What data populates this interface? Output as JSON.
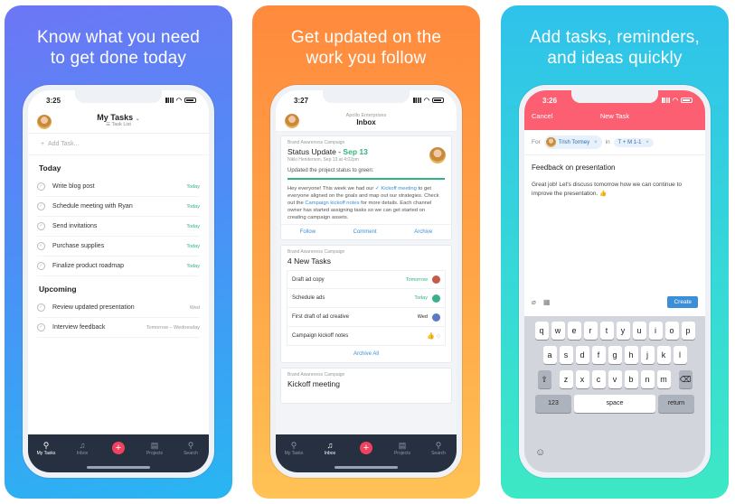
{
  "cards": [
    {
      "caption": [
        "Know what you need",
        "to get done today"
      ]
    },
    {
      "caption": [
        "Get updated on the",
        "work you follow"
      ]
    },
    {
      "caption": [
        "Add tasks, reminders,",
        "and ideas quickly"
      ]
    }
  ],
  "phone1": {
    "time": "3:25",
    "title": "My Tasks",
    "subtitle": "Task List",
    "add_task": "Add Task...",
    "today_label": "Today",
    "today_tasks": [
      {
        "label": "Write blog post",
        "due": "Today"
      },
      {
        "label": "Schedule meeting with Ryan",
        "due": "Today"
      },
      {
        "label": "Send invitations",
        "due": "Today"
      },
      {
        "label": "Purchase supplies",
        "due": "Today"
      },
      {
        "label": "Finalize product roadmap",
        "due": "Today"
      }
    ],
    "upcoming_label": "Upcoming",
    "upcoming_tasks": [
      {
        "label": "Review updated presentation",
        "due": "Wed"
      },
      {
        "label": "Interview feedback",
        "due": "Tomorrow – Wednesday"
      }
    ],
    "tabs": [
      "My Tasks",
      "Inbox",
      "",
      "Projects",
      "Search"
    ]
  },
  "phone2": {
    "time": "3:27",
    "workspace": "Apollo Enterprises",
    "title": "Inbox",
    "card1": {
      "project": "Brand Awareness Campaign",
      "title_prefix": "Status Update - ",
      "title_date": "Sep 13",
      "byline": "Nikki Henderson, Sep 13 at 4:02pm",
      "status_msg": "Updated the project status to green:",
      "body_1": "Hey everyone! This week we had our ",
      "body_link1": "✓ Kickoff meeting",
      "body_2": " to get everyone aligned on the goals and map out our strategies. Check out the ",
      "body_link2": "Campaign kickoff notes",
      "body_3": " for more details. Each channel owner has started assigning tasks so we can get started on creating campaign assets.",
      "actions": [
        "Follow",
        "Comment",
        "Archive"
      ]
    },
    "card2": {
      "project": "Brand Awareness Campaign",
      "title": "4 New Tasks",
      "tasks": [
        {
          "label": "Draft ad copy",
          "due": "Tomorrow",
          "color": "#2cb67d"
        },
        {
          "label": "Schedule ads",
          "due": "Today",
          "color": "#2cb67d"
        },
        {
          "label": "First draft of ad creative",
          "due": "Wed",
          "color": "#222222"
        },
        {
          "label": "Campaign kickoff notes",
          "due": "",
          "color": "#999999"
        }
      ],
      "archive_all": "Archive All"
    },
    "card3": {
      "project": "Brand Awareness Campaign",
      "title": "Kickoff meeting"
    },
    "tabs": [
      "My Tasks",
      "Inbox",
      "",
      "Projects",
      "Search"
    ]
  },
  "phone3": {
    "time": "3:26",
    "cancel": "Cancel",
    "title": "New Task",
    "for_label": "For",
    "assignee": "Trish Tormey",
    "in_label": "in",
    "project": "T + M 1-1",
    "task_name": "Feedback on presentation",
    "task_desc": "Great job! Let's discuss tomorrow how we can continue to improve the presentation. 👍",
    "create": "Create",
    "keyboard": {
      "row1": [
        "q",
        "w",
        "e",
        "r",
        "t",
        "y",
        "u",
        "i",
        "o",
        "p"
      ],
      "row2": [
        "a",
        "s",
        "d",
        "f",
        "g",
        "h",
        "j",
        "k",
        "l"
      ],
      "row3": [
        "z",
        "x",
        "c",
        "v",
        "b",
        "n",
        "m"
      ],
      "num": "123",
      "space": "space",
      "return": "return"
    }
  }
}
